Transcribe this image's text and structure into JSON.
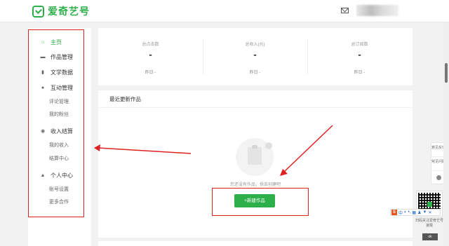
{
  "brand": {
    "name": "爱奇艺号",
    "color": "#2db04a"
  },
  "header": {
    "mail_icon": "mail-icon"
  },
  "sidebar": {
    "items": [
      {
        "label": "主页",
        "icon": "home-icon",
        "glyph": "⌂",
        "active": true
      },
      {
        "label": "作品管理",
        "icon": "folder-icon",
        "glyph": "▬"
      },
      {
        "label": "文学数据",
        "icon": "bar-chart-icon",
        "glyph": "▮"
      },
      {
        "label": "互动管理",
        "icon": "chat-icon",
        "glyph": "●",
        "subs": [
          "评论管理",
          "我的粉丝"
        ]
      },
      {
        "label": "收入结算",
        "icon": "coin-icon",
        "glyph": "◉",
        "subs": [
          "我的收入",
          "结算中心"
        ]
      },
      {
        "label": "个人中心",
        "icon": "user-icon",
        "glyph": "▲",
        "subs": [
          "账号设置",
          "更多合作"
        ]
      }
    ]
  },
  "stats": [
    {
      "label": "总点击数",
      "value": "-",
      "sub": "昨日 -"
    },
    {
      "label": "总收入(元)",
      "value": "-",
      "sub": "昨日 -"
    },
    {
      "label": "总订阅数",
      "value": "-",
      "sub": "昨日 -"
    }
  ],
  "recent": {
    "title": "最近更新作品",
    "empty_text": "您还没有作品，快去创建吧",
    "new_button": "+新建作品"
  },
  "float_panel": {
    "feedback": "意见反馈",
    "faq": "常见问题"
  },
  "qr_caption": "扫码关注爱奇艺号速报",
  "ime": {
    "logo": "S",
    "lang": "中"
  },
  "ok_label": "ok",
  "annotation_color": "#e02020"
}
